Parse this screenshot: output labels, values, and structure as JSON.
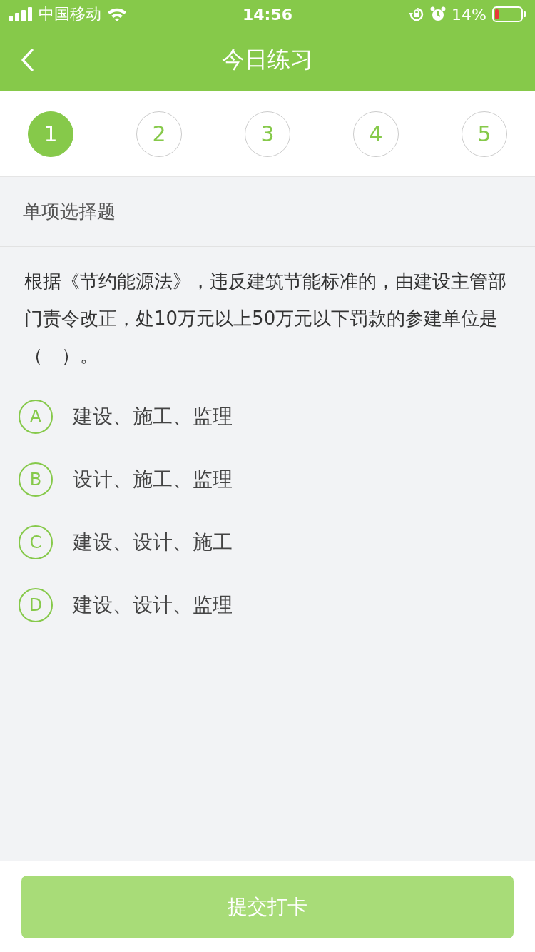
{
  "status_bar": {
    "carrier": "中国移动",
    "time": "14:56",
    "battery": "14%"
  },
  "nav": {
    "title": "今日练习"
  },
  "steps": [
    {
      "label": "1",
      "selected": true
    },
    {
      "label": "2",
      "selected": false
    },
    {
      "label": "3",
      "selected": false
    },
    {
      "label": "4",
      "selected": false
    },
    {
      "label": "5",
      "selected": false
    }
  ],
  "question_type": "单项选择题",
  "question": "根据《节约能源法》，违反建筑节能标准的，由建设主管部门责令改正，处10万元以上50万元以下罚款的参建单位是（　）。",
  "options": [
    {
      "letter": "A",
      "text": "建设、施工、监理",
      "selected": false
    },
    {
      "letter": "B",
      "text": "设计、施工、监理",
      "selected": false
    },
    {
      "letter": "C",
      "text": "建设、设计、施工",
      "selected": false
    },
    {
      "letter": "D",
      "text": "建设、设计、监理",
      "selected": false
    }
  ],
  "submit": {
    "label": "提交打卡",
    "disabled": true
  }
}
